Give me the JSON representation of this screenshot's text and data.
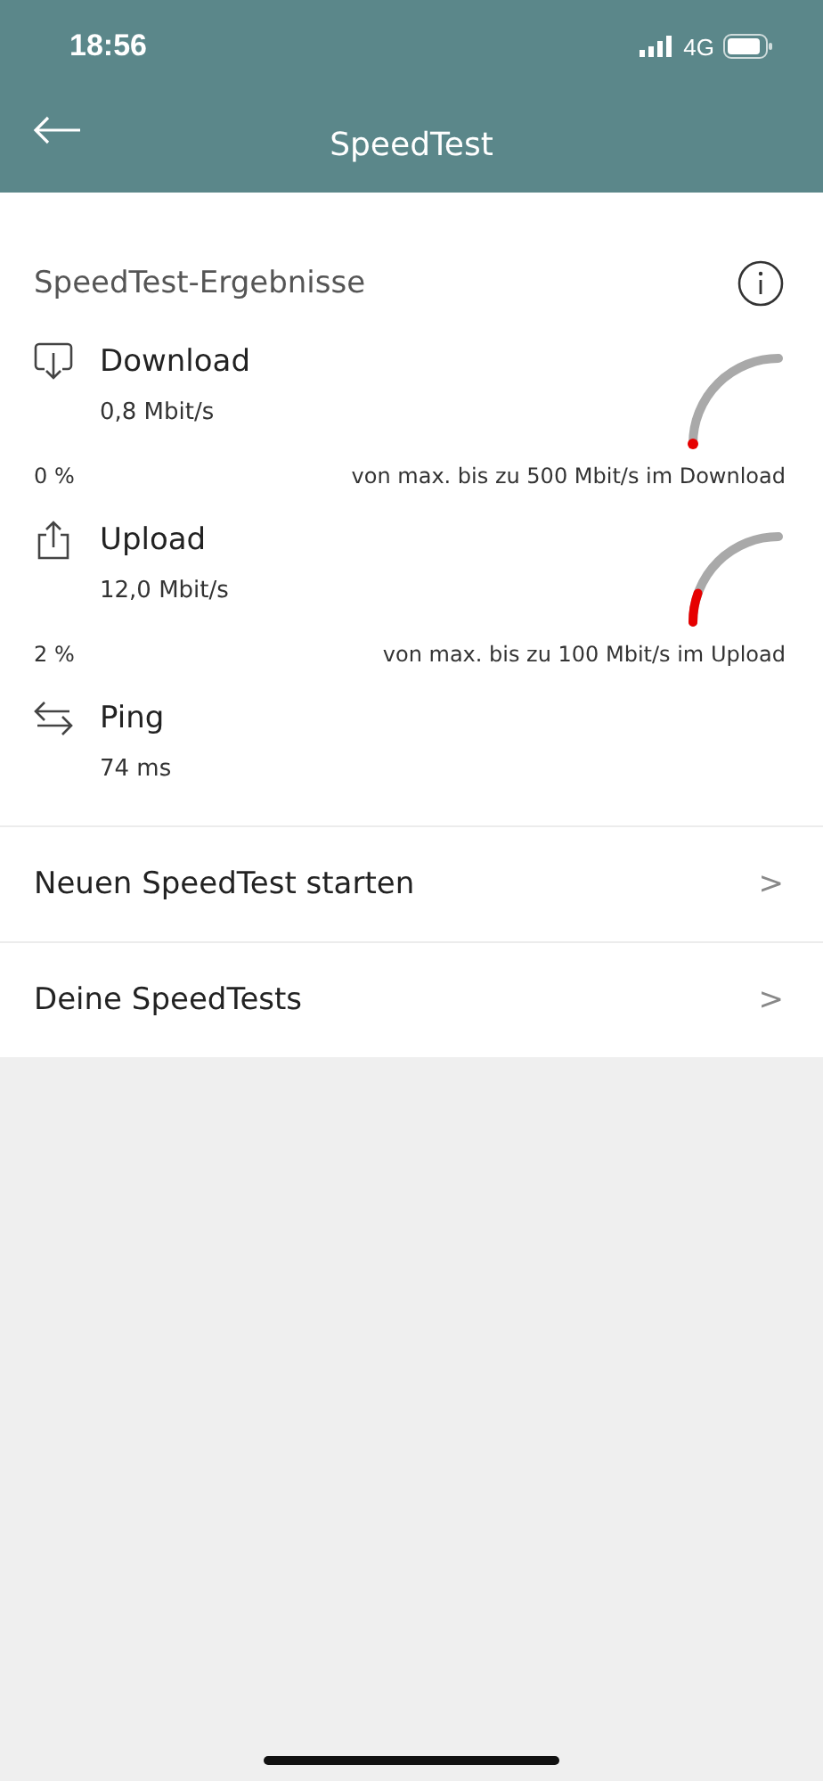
{
  "status_bar": {
    "time": "18:56",
    "network": "4G"
  },
  "header": {
    "title": "SpeedTest"
  },
  "results": {
    "title": "SpeedTest-Ergebnisse",
    "metrics": [
      {
        "kind": "download",
        "label": "Download",
        "value": "0,8 Mbit/s",
        "percent": "0 %",
        "max_text": "von max. bis zu 500 Mbit/s im Download"
      },
      {
        "kind": "upload",
        "label": "Upload",
        "value": "12,0 Mbit/s",
        "percent": "2 %",
        "max_text": "von max. bis zu 100 Mbit/s im Upload"
      },
      {
        "kind": "ping",
        "label": "Ping",
        "value": "74 ms"
      }
    ]
  },
  "menu": [
    {
      "label": "Neuen SpeedTest starten",
      "chevron": ">"
    },
    {
      "label": "Deine SpeedTests",
      "chevron": ">"
    }
  ]
}
